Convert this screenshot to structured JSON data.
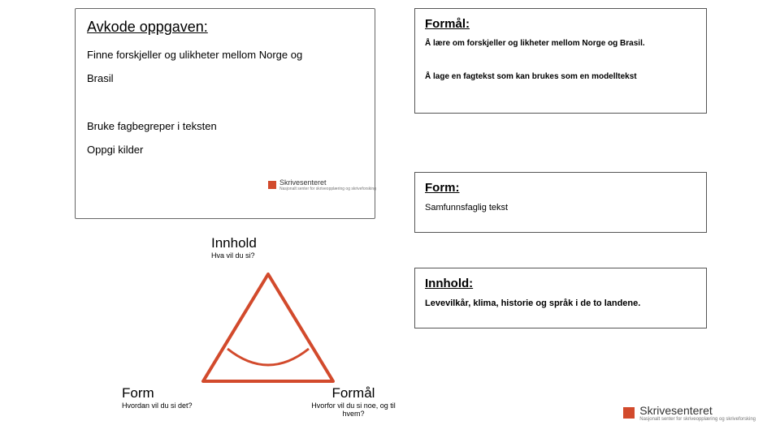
{
  "left": {
    "title": "Avkode oppgaven:",
    "line1": "Finne forskjeller og ulikheter mellom Norge og",
    "line2": "Brasil",
    "line3": "Bruke fagbegreper i teksten",
    "line4": "Oppgi kilder"
  },
  "right": {
    "formal_title": "Formål:",
    "formal_a": "Å lære om forskjeller og likheter mellom Norge og Brasil.",
    "formal_b": "Å  lage en fagtekst som kan brukes som en modelltekst",
    "form_title": "Form:",
    "form_body": "Samfunnsfaglig tekst",
    "innhold_title": "Innhold:",
    "innhold_body": "Levevilkår, klima, historie og språk i de to landene."
  },
  "triangle": {
    "top_label": "Innhold",
    "top_sub": "Hva vil du si?",
    "bl_label": "Form",
    "bl_sub": "Hvordan vil du si det?",
    "br_label": "Formål",
    "br_sub": "Hvorfor vil du si noe, og til hvem?"
  },
  "logo": {
    "name": "Skrivesenteret",
    "sub": "Nasjonalt senter for skriveopplæring og skriveforsking"
  }
}
